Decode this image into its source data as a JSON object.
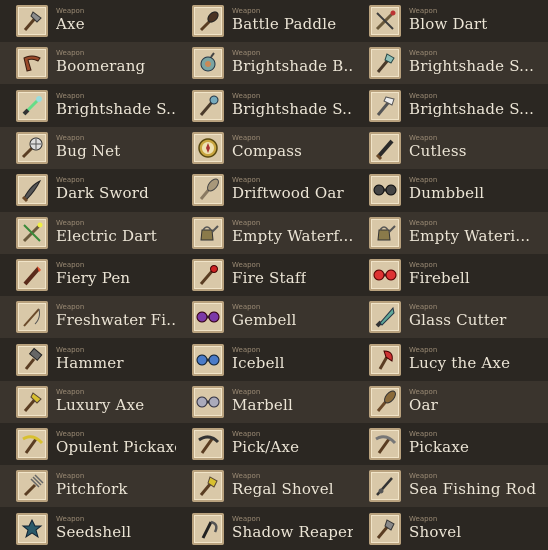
{
  "category_label": "Weapon",
  "colors": {
    "background": "#2b2722",
    "band_light": "#3a342d",
    "icon_bg": "#d9c8a8",
    "text": "#ece5d6"
  },
  "items": [
    {
      "name": "Axe",
      "icon": "axe-icon"
    },
    {
      "name": "Battle Paddle",
      "icon": "paddle-icon"
    },
    {
      "name": "Blow Dart",
      "icon": "blow-dart-icon"
    },
    {
      "name": "Boomerang",
      "icon": "boomerang-icon"
    },
    {
      "name": "Brightshade B...",
      "icon": "brightshade-bomb-icon"
    },
    {
      "name": "Brightshade S...",
      "icon": "brightshade-shovel-icon"
    },
    {
      "name": "Brightshade S...",
      "icon": "brightshade-sword-icon"
    },
    {
      "name": "Brightshade S...",
      "icon": "brightshade-staff-icon"
    },
    {
      "name": "Brightshade S...",
      "icon": "brightshade-smasher-icon"
    },
    {
      "name": "Bug Net",
      "icon": "bug-net-icon"
    },
    {
      "name": "Compass",
      "icon": "compass-icon"
    },
    {
      "name": "Cutless",
      "icon": "cutless-icon"
    },
    {
      "name": "Dark Sword",
      "icon": "dark-sword-icon"
    },
    {
      "name": "Driftwood Oar",
      "icon": "driftwood-oar-icon"
    },
    {
      "name": "Dumbbell",
      "icon": "dumbbell-icon"
    },
    {
      "name": "Electric Dart",
      "icon": "electric-dart-icon"
    },
    {
      "name": "Empty Waterf...",
      "icon": "watering-can-icon"
    },
    {
      "name": "Empty Wateri...",
      "icon": "watering-can-icon"
    },
    {
      "name": "Fiery Pen",
      "icon": "fiery-pen-icon"
    },
    {
      "name": "Fire Staff",
      "icon": "fire-staff-icon"
    },
    {
      "name": "Firebell",
      "icon": "firebell-icon"
    },
    {
      "name": "Freshwater Fi...",
      "icon": "fishing-rod-icon"
    },
    {
      "name": "Gembell",
      "icon": "gembell-icon"
    },
    {
      "name": "Glass Cutter",
      "icon": "glass-cutter-icon"
    },
    {
      "name": "Hammer",
      "icon": "hammer-icon"
    },
    {
      "name": "Icebell",
      "icon": "icebell-icon"
    },
    {
      "name": "Lucy the Axe",
      "icon": "lucy-axe-icon"
    },
    {
      "name": "Luxury Axe",
      "icon": "luxury-axe-icon"
    },
    {
      "name": "Marbell",
      "icon": "marbell-icon"
    },
    {
      "name": "Oar",
      "icon": "oar-icon"
    },
    {
      "name": "Opulent Pickaxe",
      "icon": "opulent-pickaxe-icon"
    },
    {
      "name": "Pick/Axe",
      "icon": "pick-axe-icon"
    },
    {
      "name": "Pickaxe",
      "icon": "pickaxe-icon"
    },
    {
      "name": "Pitchfork",
      "icon": "pitchfork-icon"
    },
    {
      "name": "Regal Shovel",
      "icon": "regal-shovel-icon"
    },
    {
      "name": "Sea Fishing Rod",
      "icon": "sea-fishing-rod-icon"
    },
    {
      "name": "Seedshell",
      "icon": "seedshell-icon"
    },
    {
      "name": "Shadow Reaper",
      "icon": "shadow-reaper-icon"
    },
    {
      "name": "Shovel",
      "icon": "shovel-icon"
    }
  ]
}
